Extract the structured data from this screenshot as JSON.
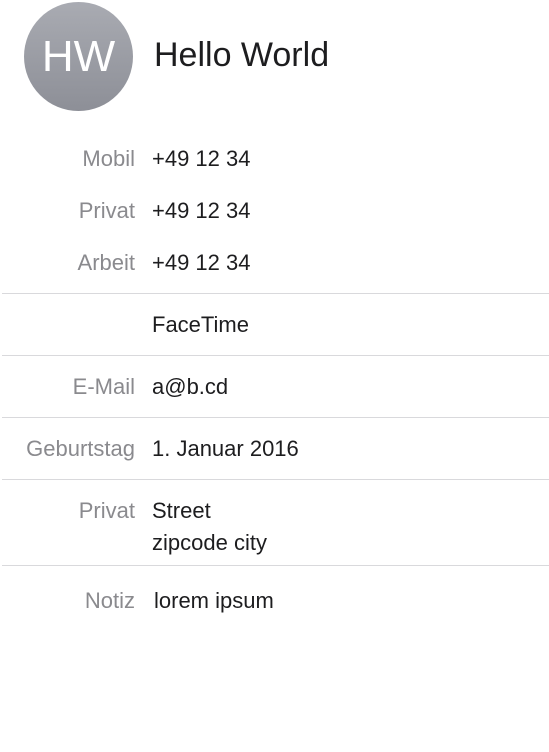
{
  "contact": {
    "initials": "HW",
    "name": "Hello World"
  },
  "phones": [
    {
      "label": "Mobil",
      "value": "+49 12 34"
    },
    {
      "label": "Privat",
      "value": "+49 12 34"
    },
    {
      "label": "Arbeit",
      "value": "+49 12 34"
    }
  ],
  "facetime": {
    "label": "FaceTime"
  },
  "email": {
    "label": "E-Mail",
    "value": "a@b.cd"
  },
  "birthday": {
    "label": "Geburtstag",
    "value": "1. Januar 2016"
  },
  "address": {
    "label": "Privat",
    "street": "Street",
    "city_line": "zipcode city"
  },
  "note": {
    "label": "Notiz",
    "value": "lorem ipsum"
  },
  "colors": {
    "label_gray": "#8a8a8e",
    "value_text": "#1d1d1f",
    "divider": "#d9d9dc",
    "avatar": "#9a9ca3"
  }
}
